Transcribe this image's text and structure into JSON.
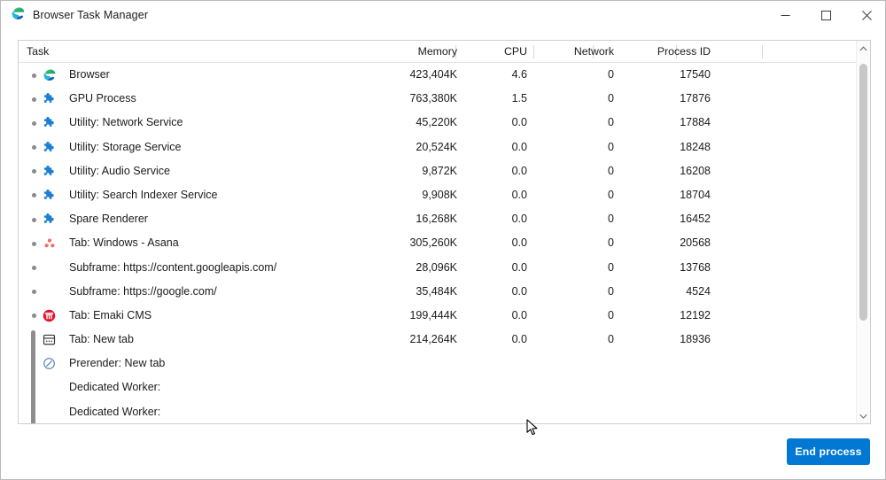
{
  "window": {
    "title": "Browser Task Manager",
    "app_icon": "edge-logo-icon",
    "controls": {
      "minimize": "—",
      "maximize": "□",
      "close": "✕"
    }
  },
  "table": {
    "columns": {
      "task": "Task",
      "memory": "Memory",
      "cpu": "CPU",
      "network": "Network",
      "process_id": "Process ID"
    },
    "rows": [
      {
        "name": "Browser",
        "memory": "423,404K",
        "cpu": "4.6",
        "network": "0",
        "pid": "17540",
        "icon": "edge-logo-icon",
        "bullet": true,
        "grouped": false
      },
      {
        "name": "GPU Process",
        "memory": "763,380K",
        "cpu": "1.5",
        "network": "0",
        "pid": "17876",
        "icon": "puzzle-piece-icon",
        "bullet": true,
        "grouped": false
      },
      {
        "name": "Utility: Network Service",
        "memory": "45,220K",
        "cpu": "0.0",
        "network": "0",
        "pid": "17884",
        "icon": "puzzle-piece-icon",
        "bullet": true,
        "grouped": false
      },
      {
        "name": "Utility: Storage Service",
        "memory": "20,524K",
        "cpu": "0.0",
        "network": "0",
        "pid": "18248",
        "icon": "puzzle-piece-icon",
        "bullet": true,
        "grouped": false
      },
      {
        "name": "Utility: Audio Service",
        "memory": "9,872K",
        "cpu": "0.0",
        "network": "0",
        "pid": "16208",
        "icon": "puzzle-piece-icon",
        "bullet": true,
        "grouped": false
      },
      {
        "name": "Utility: Search Indexer Service",
        "memory": "9,908K",
        "cpu": "0.0",
        "network": "0",
        "pid": "18704",
        "icon": "puzzle-piece-icon",
        "bullet": true,
        "grouped": false
      },
      {
        "name": "Spare Renderer",
        "memory": "16,268K",
        "cpu": "0.0",
        "network": "0",
        "pid": "16452",
        "icon": "puzzle-piece-icon",
        "bullet": true,
        "grouped": false
      },
      {
        "name": "Tab: Windows - Asana",
        "memory": "305,260K",
        "cpu": "0.0",
        "network": "0",
        "pid": "20568",
        "icon": "asana-favicon",
        "bullet": true,
        "grouped": false
      },
      {
        "name": "Subframe: https://content.googleapis.com/",
        "memory": "28,096K",
        "cpu": "0.0",
        "network": "0",
        "pid": "13768",
        "icon": "none",
        "bullet": true,
        "grouped": false
      },
      {
        "name": "Subframe: https://google.com/",
        "memory": "35,484K",
        "cpu": "0.0",
        "network": "0",
        "pid": "4524",
        "icon": "none",
        "bullet": true,
        "grouped": false
      },
      {
        "name": "Tab: Emaki CMS",
        "memory": "199,444K",
        "cpu": "0.0",
        "network": "0",
        "pid": "12192",
        "icon": "emaki-favicon",
        "bullet": true,
        "grouped": false
      },
      {
        "name": "Tab: New tab",
        "memory": "214,264K",
        "cpu": "0.0",
        "network": "0",
        "pid": "18936",
        "icon": "new-tab-icon",
        "bullet": false,
        "grouped": true
      },
      {
        "name": "Prerender: New tab",
        "memory": "",
        "cpu": "",
        "network": "",
        "pid": "",
        "icon": "prerender-icon",
        "bullet": false,
        "grouped": true
      },
      {
        "name": "Dedicated Worker:",
        "memory": "",
        "cpu": "",
        "network": "",
        "pid": "",
        "icon": "none",
        "bullet": false,
        "grouped": true
      },
      {
        "name": "Dedicated Worker:",
        "memory": "",
        "cpu": "",
        "network": "",
        "pid": "",
        "icon": "none",
        "bullet": false,
        "grouped": true
      }
    ]
  },
  "scrollbar": {
    "up_arrow": "chevron-up-icon",
    "down_arrow": "chevron-down-icon"
  },
  "footer": {
    "end_process_label": "End process"
  },
  "colors": {
    "accent": "#0078d4",
    "text": "#1b1b1b",
    "border": "#cfcfcf",
    "bullet": "#8a8a8a",
    "group_bar": "#8d8d8d",
    "puzzle": "#1a7fd4",
    "asana": "#f06a6a",
    "emaki": "#e8112d"
  }
}
